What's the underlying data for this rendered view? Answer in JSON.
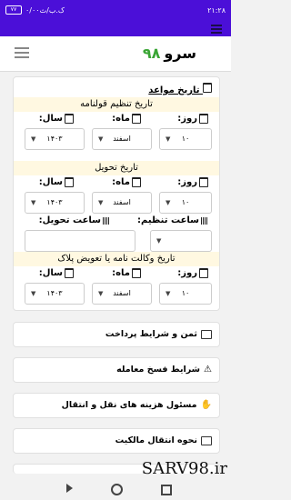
{
  "status": {
    "time": "۲۱:۲۸",
    "left_text": "۰/۰۰ک.ب/ث",
    "battery": "٧٧"
  },
  "header": {
    "brand_text": "سرو",
    "brand_number": "۹۸"
  },
  "dates": {
    "title": "تاریخ مواعد",
    "labels": {
      "day": "روز:",
      "month": "ماه:",
      "year": "سال:"
    },
    "sections": [
      {
        "title": "تاریخ تنظیم قولنامه",
        "day": "۱۰",
        "month": "اسفند",
        "year": "۱۴۰۳"
      },
      {
        "title": "تاریخ تحویل",
        "day": "۱۰",
        "month": "اسفند",
        "year": "۱۴۰۳"
      },
      {
        "title": "تاریخ وکالت نامه یا تعویض پلاک",
        "day": "۱۰",
        "month": "اسفند",
        "year": "۱۴۰۳"
      }
    ],
    "times": {
      "set_label": "ساعت تنظیم:",
      "delivery_label": "ساعت تحویل:"
    }
  },
  "rows": [
    {
      "label": "ثمن و شرایط پرداخت",
      "icon": "money-icon"
    },
    {
      "label": "شرایط فسخ معامله",
      "icon": "warning-icon"
    },
    {
      "label": "مسئول هزینه های نقل و انتقال",
      "icon": "handshake-icon"
    },
    {
      "label": "نحوه انتقال مالکیت",
      "icon": "transfer-icon"
    }
  ],
  "watermark": "SARV98.ir"
}
